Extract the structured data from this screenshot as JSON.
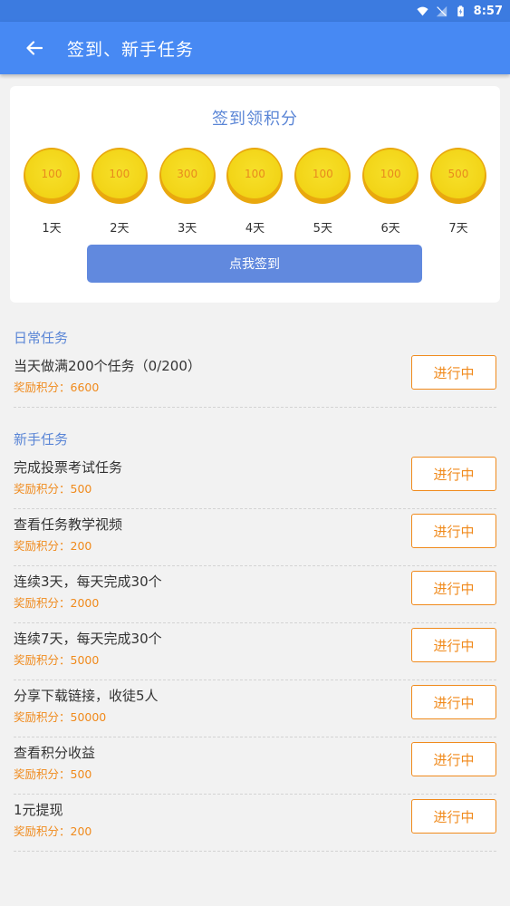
{
  "status_bar": {
    "time": "8:57"
  },
  "app_bar": {
    "title": "签到、新手任务"
  },
  "checkin": {
    "title": "签到领积分",
    "days": [
      {
        "points": "100",
        "label": "1天"
      },
      {
        "points": "100",
        "label": "2天"
      },
      {
        "points": "300",
        "label": "3天"
      },
      {
        "points": "100",
        "label": "4天"
      },
      {
        "points": "100",
        "label": "5天"
      },
      {
        "points": "100",
        "label": "6天"
      },
      {
        "points": "500",
        "label": "7天"
      }
    ],
    "button_label": "点我签到"
  },
  "daily": {
    "title": "日常任务",
    "tasks": [
      {
        "name": "当天做满200个任务（0/200）",
        "reward": "奖励积分：6600",
        "status": "进行中"
      }
    ]
  },
  "newbie": {
    "title": "新手任务",
    "tasks": [
      {
        "name": "完成投票考试任务",
        "reward": "奖励积分：500",
        "status": "进行中"
      },
      {
        "name": "查看任务教学视频",
        "reward": "奖励积分：200",
        "status": "进行中"
      },
      {
        "name": "连续3天，每天完成30个",
        "reward": "奖励积分：2000",
        "status": "进行中"
      },
      {
        "name": "连续7天，每天完成30个",
        "reward": "奖励积分：5000",
        "status": "进行中"
      },
      {
        "name": "分享下载链接，收徒5人",
        "reward": "奖励积分：50000",
        "status": "进行中"
      },
      {
        "name": "查看积分收益",
        "reward": "奖励积分：500",
        "status": "进行中"
      },
      {
        "name": "1元提现",
        "reward": "奖励积分：200",
        "status": "进行中"
      }
    ]
  },
  "colors": {
    "status_bar": "#3c7be0",
    "app_bar": "#4789f3",
    "accent_blue": "#5b86d6",
    "orange": "#f08a1c",
    "coin_gold": "#f2d417"
  }
}
